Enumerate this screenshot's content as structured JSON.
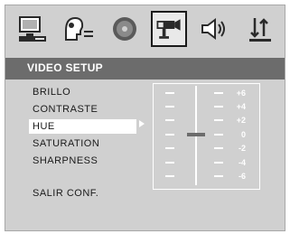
{
  "header": {
    "title": "VIDEO SETUP"
  },
  "toolbar": {
    "icons": [
      "system-setup-icon",
      "language-setup-icon",
      "audio-disc-icon",
      "video-setup-icon",
      "speaker-setup-icon",
      "preference-sort-icon"
    ],
    "active": "video-setup-icon"
  },
  "menu": {
    "items": [
      "BRILLO",
      "CONTRASTE",
      "HUE",
      "SATURATION",
      "SHARPNESS",
      "SALIR CONF."
    ],
    "selected": "HUE"
  },
  "slider": {
    "ticks": [
      "+6",
      "+4",
      "+2",
      "0",
      "-2",
      "-4",
      "-6"
    ],
    "current_value": 0
  },
  "colors": {
    "background": "#d0d0d0",
    "header": "#6c6c6c",
    "selection": "#ffffff",
    "border": "#a8a8a8"
  }
}
